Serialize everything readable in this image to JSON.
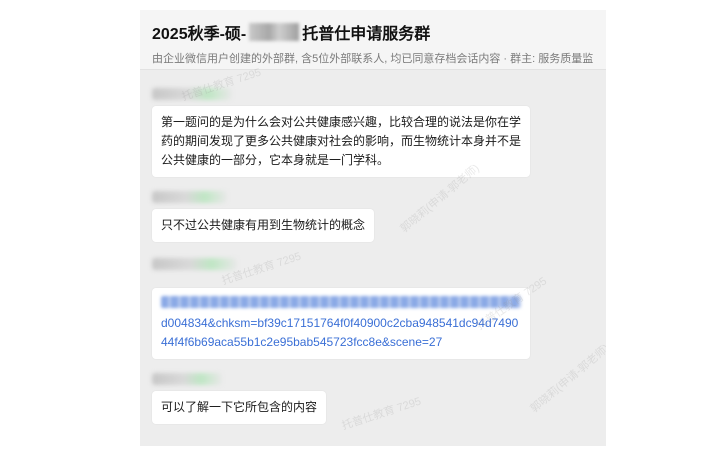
{
  "header": {
    "title_prefix": "2025秋季-硕-",
    "title_suffix": "托普仕申请服务群",
    "subtitle": "由企业微信用户创建的外部群, 含5位外部联系人, 均已同意存档会话内容 · 群主: 服务质量监"
  },
  "messages": [
    {
      "text": "第一题问的是为什么会对公共健康感兴趣，比较合理的说法是你在学药的期间发现了更多公共健康对社会的影响，而生物统计本身并不是公共健康的一部分，它本身就是一门学科。"
    },
    {
      "text": "只不过公共健康有用到生物统计的概念"
    },
    {
      "link_visible": "d004834&chksm=bf39c17151764f0f40900c2cba948541dc94d749044f4f6b69aca55b1c2e95bab545723fcc8e&scene=27"
    },
    {
      "text": "可以了解一下它所包含的内容"
    }
  ],
  "watermarks": {
    "company": "托普仕教育 7295",
    "person": "郭晓莉(申请-郭老师)"
  }
}
